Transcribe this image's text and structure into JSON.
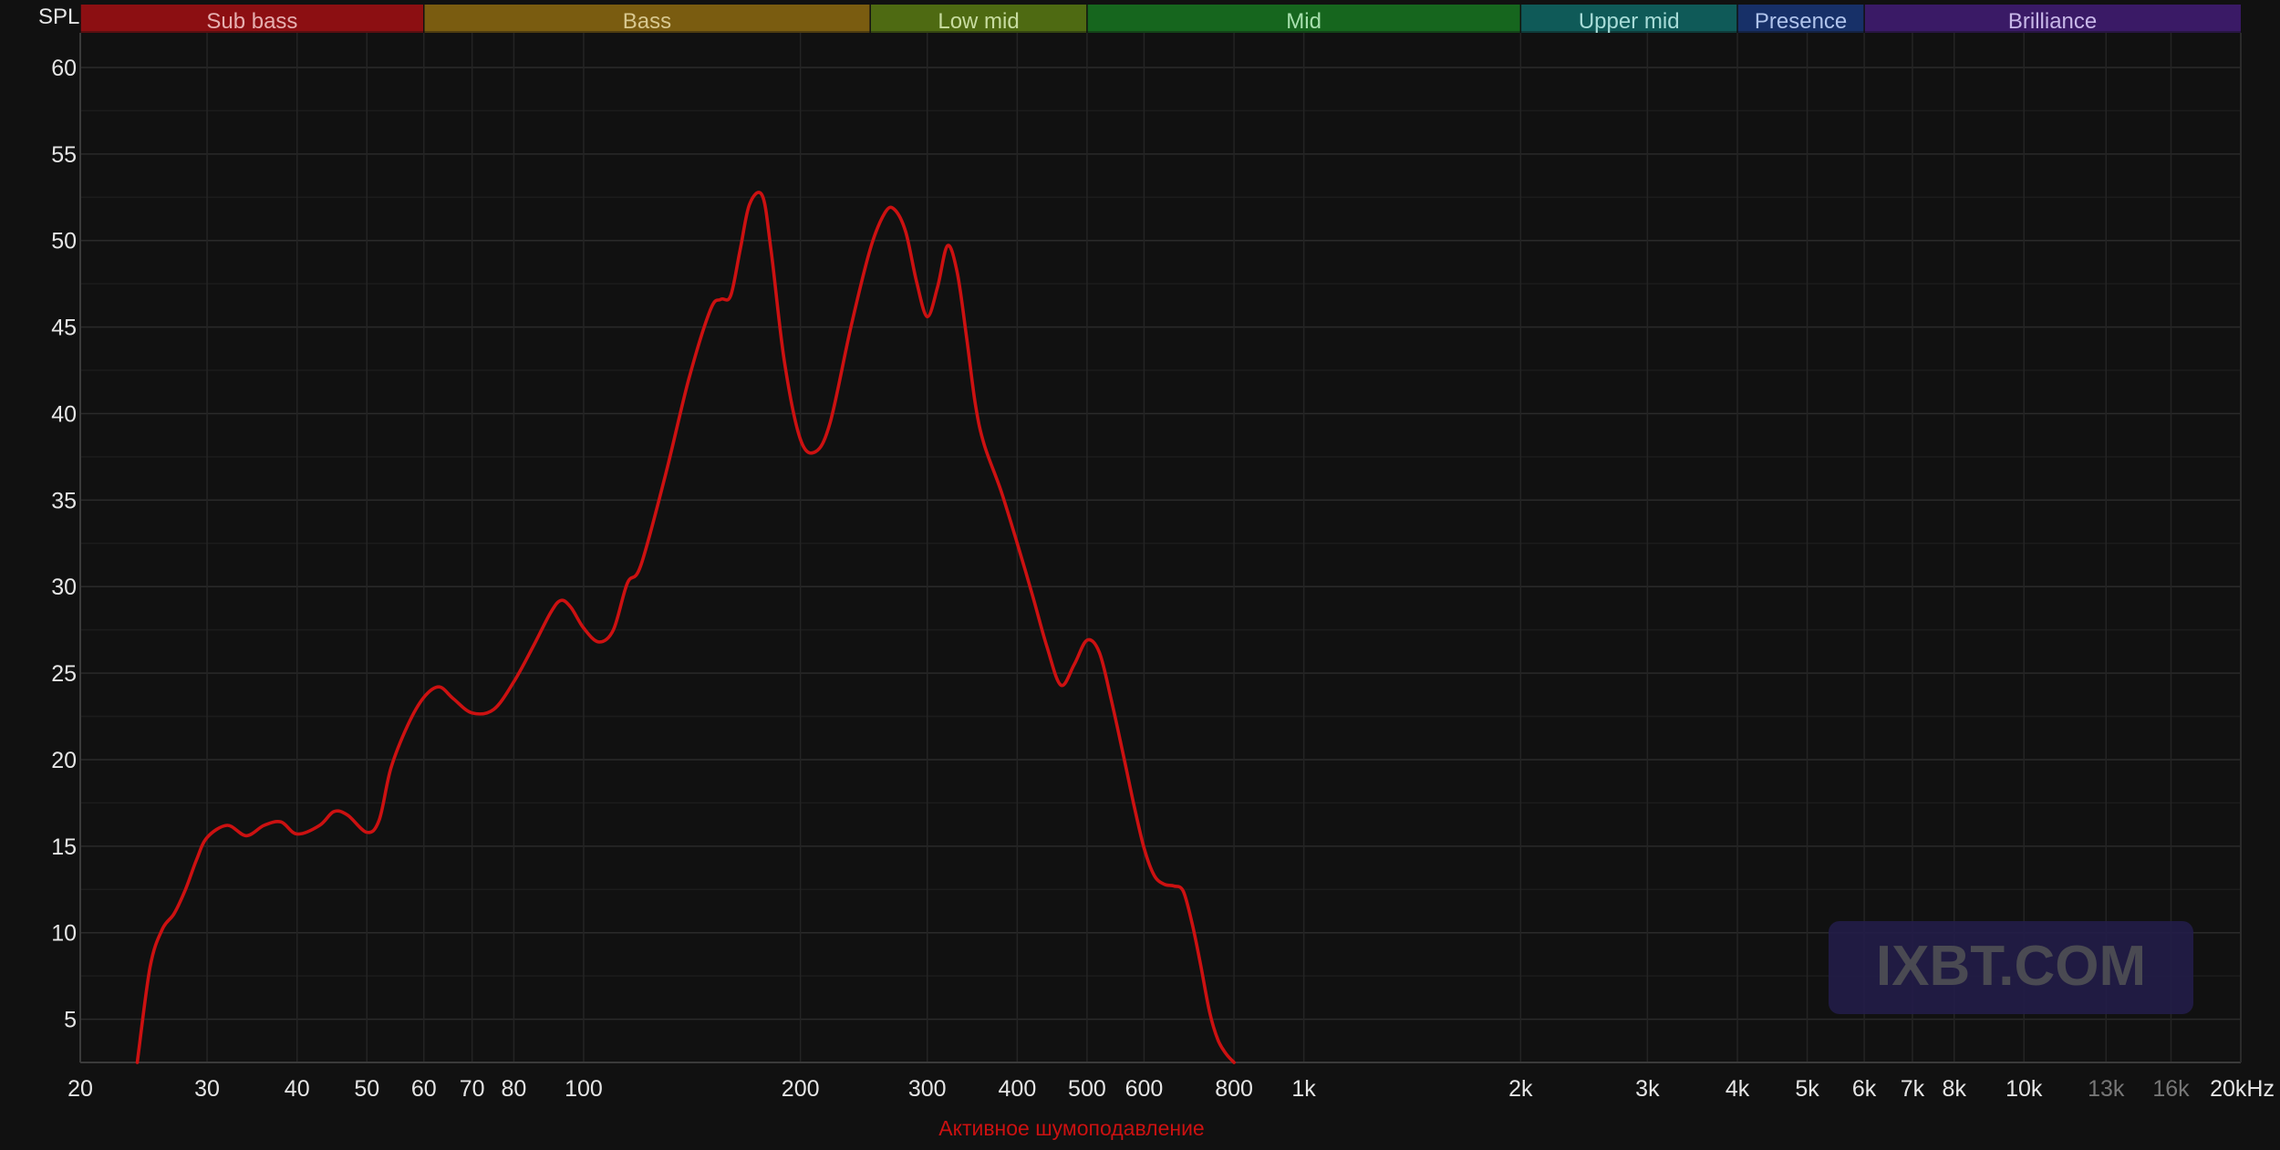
{
  "chart_data": {
    "type": "line",
    "title": "",
    "ylabel": "SPL",
    "xlabel": "",
    "x_scale": "log",
    "xlim": [
      20,
      20000
    ],
    "ylim": [
      2.5,
      62
    ],
    "grid": true,
    "bands": [
      {
        "label": "Sub bass",
        "from": 20,
        "to": 60,
        "color": "#8c0f12",
        "text_color": "#e6b0b0"
      },
      {
        "label": "Bass",
        "from": 60,
        "to": 250,
        "color": "#7a5c10",
        "text_color": "#d8c890"
      },
      {
        "label": "Low mid",
        "from": 250,
        "to": 500,
        "color": "#4e6a12",
        "text_color": "#c8dca0"
      },
      {
        "label": "Mid",
        "from": 500,
        "to": 2000,
        "color": "#16661e",
        "text_color": "#a8e0ae"
      },
      {
        "label": "Upper mid",
        "from": 2000,
        "to": 4000,
        "color": "#0f5a58",
        "text_color": "#a8dcd8"
      },
      {
        "label": "Presence",
        "from": 4000,
        "to": 6000,
        "color": "#173068",
        "text_color": "#b0c4ec"
      },
      {
        "label": "Brilliance",
        "from": 6000,
        "to": 20000,
        "color": "#3a1a66",
        "text_color": "#c8b8e8"
      }
    ],
    "y_ticks": [
      {
        "value": 5,
        "label": "5"
      },
      {
        "value": 10,
        "label": "10"
      },
      {
        "value": 15,
        "label": "15"
      },
      {
        "value": 20,
        "label": "20"
      },
      {
        "value": 25,
        "label": "25"
      },
      {
        "value": 30,
        "label": "30"
      },
      {
        "value": 35,
        "label": "35"
      },
      {
        "value": 40,
        "label": "40"
      },
      {
        "value": 45,
        "label": "45"
      },
      {
        "value": 50,
        "label": "50"
      },
      {
        "value": 55,
        "label": "55"
      },
      {
        "value": 60,
        "label": "60"
      }
    ],
    "x_ticks": [
      {
        "value": 20,
        "label": "20",
        "dim": false
      },
      {
        "value": 30,
        "label": "30",
        "dim": false
      },
      {
        "value": 40,
        "label": "40",
        "dim": false
      },
      {
        "value": 50,
        "label": "50",
        "dim": false
      },
      {
        "value": 60,
        "label": "60",
        "dim": false
      },
      {
        "value": 70,
        "label": "70",
        "dim": false
      },
      {
        "value": 80,
        "label": "80",
        "dim": false
      },
      {
        "value": 100,
        "label": "100",
        "dim": false
      },
      {
        "value": 200,
        "label": "200",
        "dim": false
      },
      {
        "value": 300,
        "label": "300",
        "dim": false
      },
      {
        "value": 400,
        "label": "400",
        "dim": false
      },
      {
        "value": 500,
        "label": "500",
        "dim": false
      },
      {
        "value": 600,
        "label": "600",
        "dim": false
      },
      {
        "value": 800,
        "label": "800",
        "dim": false
      },
      {
        "value": 1000,
        "label": "1k",
        "dim": false
      },
      {
        "value": 2000,
        "label": "2k",
        "dim": false
      },
      {
        "value": 3000,
        "label": "3k",
        "dim": false
      },
      {
        "value": 4000,
        "label": "4k",
        "dim": false
      },
      {
        "value": 5000,
        "label": "5k",
        "dim": false
      },
      {
        "value": 6000,
        "label": "6k",
        "dim": false
      },
      {
        "value": 7000,
        "label": "7k",
        "dim": false
      },
      {
        "value": 8000,
        "label": "8k",
        "dim": false
      },
      {
        "value": 10000,
        "label": "10k",
        "dim": false
      },
      {
        "value": 13000,
        "label": "13k",
        "dim": true
      },
      {
        "value": 16000,
        "label": "16k",
        "dim": true
      },
      {
        "value": 20000,
        "label": "20kHz",
        "dim": false
      }
    ],
    "series": [
      {
        "name": "Активное шумоподавление",
        "color": "#cc1111",
        "x": [
          24,
          25,
          26,
          27,
          28,
          29,
          30,
          32,
          34,
          36,
          38,
          40,
          43,
          45,
          47,
          50,
          52,
          54,
          57,
          60,
          63,
          66,
          70,
          75,
          80,
          85,
          90,
          93,
          96,
          100,
          105,
          110,
          115,
          120,
          130,
          140,
          150,
          155,
          160,
          165,
          170,
          177,
          182,
          190,
          200,
          210,
          220,
          235,
          250,
          262,
          270,
          280,
          290,
          300,
          310,
          320,
          330,
          340,
          350,
          360,
          380,
          400,
          420,
          440,
          460,
          480,
          500,
          520,
          540,
          560,
          580,
          600,
          620,
          640,
          660,
          680,
          700,
          720,
          740,
          760,
          780,
          800
        ],
        "y": [
          2.5,
          8,
          10.2,
          11.1,
          12.5,
          14.2,
          15.5,
          16.2,
          15.6,
          16.2,
          16.4,
          15.7,
          16.2,
          17,
          16.8,
          15.8,
          16.5,
          19.5,
          22,
          23.6,
          24.2,
          23.5,
          22.7,
          22.9,
          24.5,
          26.5,
          28.5,
          29.2,
          28.8,
          27.6,
          26.8,
          27.5,
          30.2,
          31.2,
          36.5,
          42,
          46,
          46.6,
          46.8,
          49.5,
          52.1,
          52.6,
          49.5,
          43,
          38.5,
          37.8,
          39.5,
          45,
          49.5,
          51.6,
          51.8,
          50.5,
          47.6,
          45.6,
          47.3,
          49.7,
          48.2,
          44.5,
          40.5,
          38.2,
          35.5,
          32.5,
          29.5,
          26.5,
          24.3,
          25.5,
          26.9,
          26.2,
          23.5,
          20.5,
          17.5,
          14.9,
          13.3,
          12.8,
          12.7,
          12.4,
          10.5,
          8,
          5.4,
          3.8,
          3,
          2.5
        ]
      }
    ],
    "watermark": "IXBT.COM"
  }
}
